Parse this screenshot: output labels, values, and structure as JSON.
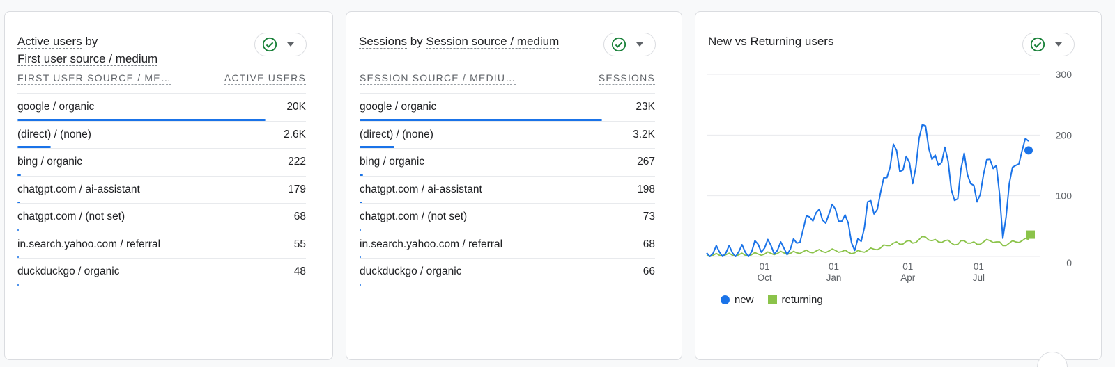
{
  "card1": {
    "title_part1": "Active users",
    "title_by": " by",
    "title_part2": "First user source / medium",
    "col_left": "FIRST USER SOURCE / ME…",
    "col_right": "ACTIVE USERS",
    "rows": [
      {
        "label": "google / organic",
        "value": "20K",
        "share": 0.86
      },
      {
        "label": "(direct) / (none)",
        "value": "2.6K",
        "share": 0.115
      },
      {
        "label": "bing / organic",
        "value": "222",
        "share": 0.012
      },
      {
        "label": "chatgpt.com / ai-assistant",
        "value": "179",
        "share": 0.009
      },
      {
        "label": "chatgpt.com / (not set)",
        "value": "68",
        "share": 0.004
      },
      {
        "label": "in.search.yahoo.com / referral",
        "value": "55",
        "share": 0.003
      },
      {
        "label": "duckduckgo / organic",
        "value": "48",
        "share": 0.002
      }
    ]
  },
  "card2": {
    "title_part1": "Sessions",
    "title_by": " by ",
    "title_part2": "Session source / medium",
    "col_left": "SESSION SOURCE / MEDIU…",
    "col_right": "SESSIONS",
    "rows": [
      {
        "label": "google / organic",
        "value": "23K",
        "share": 0.84
      },
      {
        "label": "(direct) / (none)",
        "value": "3.2K",
        "share": 0.12
      },
      {
        "label": "bing / organic",
        "value": "267",
        "share": 0.012
      },
      {
        "label": "chatgpt.com / ai-assistant",
        "value": "198",
        "share": 0.009
      },
      {
        "label": "chatgpt.com / (not set)",
        "value": "73",
        "share": 0.004
      },
      {
        "label": "in.search.yahoo.com / referral",
        "value": "68",
        "share": 0.003
      },
      {
        "label": "duckduckgo / organic",
        "value": "66",
        "share": 0.002
      }
    ]
  },
  "card3": {
    "title": "New vs Returning users"
  },
  "colors": {
    "accent": "#1a73e8",
    "returning": "#8bc34a",
    "check": "#188038"
  },
  "icons": [
    "check-circle-icon",
    "caret-down-icon"
  ],
  "chart_data": {
    "type": "line",
    "title": "New vs Returning users",
    "x_ticks": [
      {
        "top": "01",
        "bottom": "Oct"
      },
      {
        "top": "01",
        "bottom": "Jan"
      },
      {
        "top": "01",
        "bottom": "Apr"
      },
      {
        "top": "01",
        "bottom": "Jul"
      }
    ],
    "y_ticks": [
      "300",
      "200",
      "100",
      "0"
    ],
    "ylim": [
      0,
      300
    ],
    "grid": true,
    "legend_position": "bottom-left",
    "series": [
      {
        "name": "new",
        "color": "#1a73e8",
        "x_week": [
          0,
          1,
          2,
          3,
          4,
          5,
          6,
          7,
          8,
          9,
          10,
          11,
          12,
          13,
          14,
          15,
          16,
          17,
          18,
          19,
          20,
          21,
          22,
          23,
          24,
          25,
          26,
          27,
          28,
          29,
          30,
          31,
          32,
          33,
          34,
          35,
          36,
          37,
          38,
          39,
          40,
          41,
          42,
          43,
          44,
          45,
          46,
          47,
          48,
          49,
          50
        ],
        "values": [
          6,
          5,
          7,
          6,
          6,
          8,
          7,
          8,
          20,
          14,
          18,
          10,
          14,
          12,
          22,
          45,
          65,
          72,
          60,
          70,
          78,
          58,
          55,
          10,
          25,
          90,
          70,
          105,
          130,
          185,
          140,
          165,
          120,
          195,
          215,
          160,
          150,
          180,
          110,
          95,
          170,
          120,
          90,
          135,
          160,
          150,
          30,
          120,
          150,
          175,
          190
        ]
      },
      {
        "name": "returning",
        "color": "#8bc34a",
        "x_week": [
          0,
          1,
          2,
          3,
          4,
          5,
          6,
          7,
          8,
          9,
          10,
          11,
          12,
          13,
          14,
          15,
          16,
          17,
          18,
          19,
          20,
          21,
          22,
          23,
          24,
          25,
          26,
          27,
          28,
          29,
          30,
          31,
          32,
          33,
          34,
          35,
          36,
          37,
          38,
          39,
          40,
          41,
          42,
          43,
          44,
          45,
          46,
          47,
          48,
          49,
          50
        ],
        "values": [
          2,
          2,
          2,
          3,
          2,
          3,
          2,
          3,
          4,
          4,
          5,
          5,
          6,
          5,
          6,
          8,
          7,
          9,
          8,
          9,
          10,
          8,
          7,
          6,
          8,
          10,
          12,
          14,
          18,
          22,
          20,
          25,
          22,
          28,
          32,
          26,
          24,
          26,
          22,
          20,
          26,
          22,
          20,
          24,
          26,
          24,
          18,
          22,
          24,
          26,
          28
        ]
      }
    ]
  }
}
